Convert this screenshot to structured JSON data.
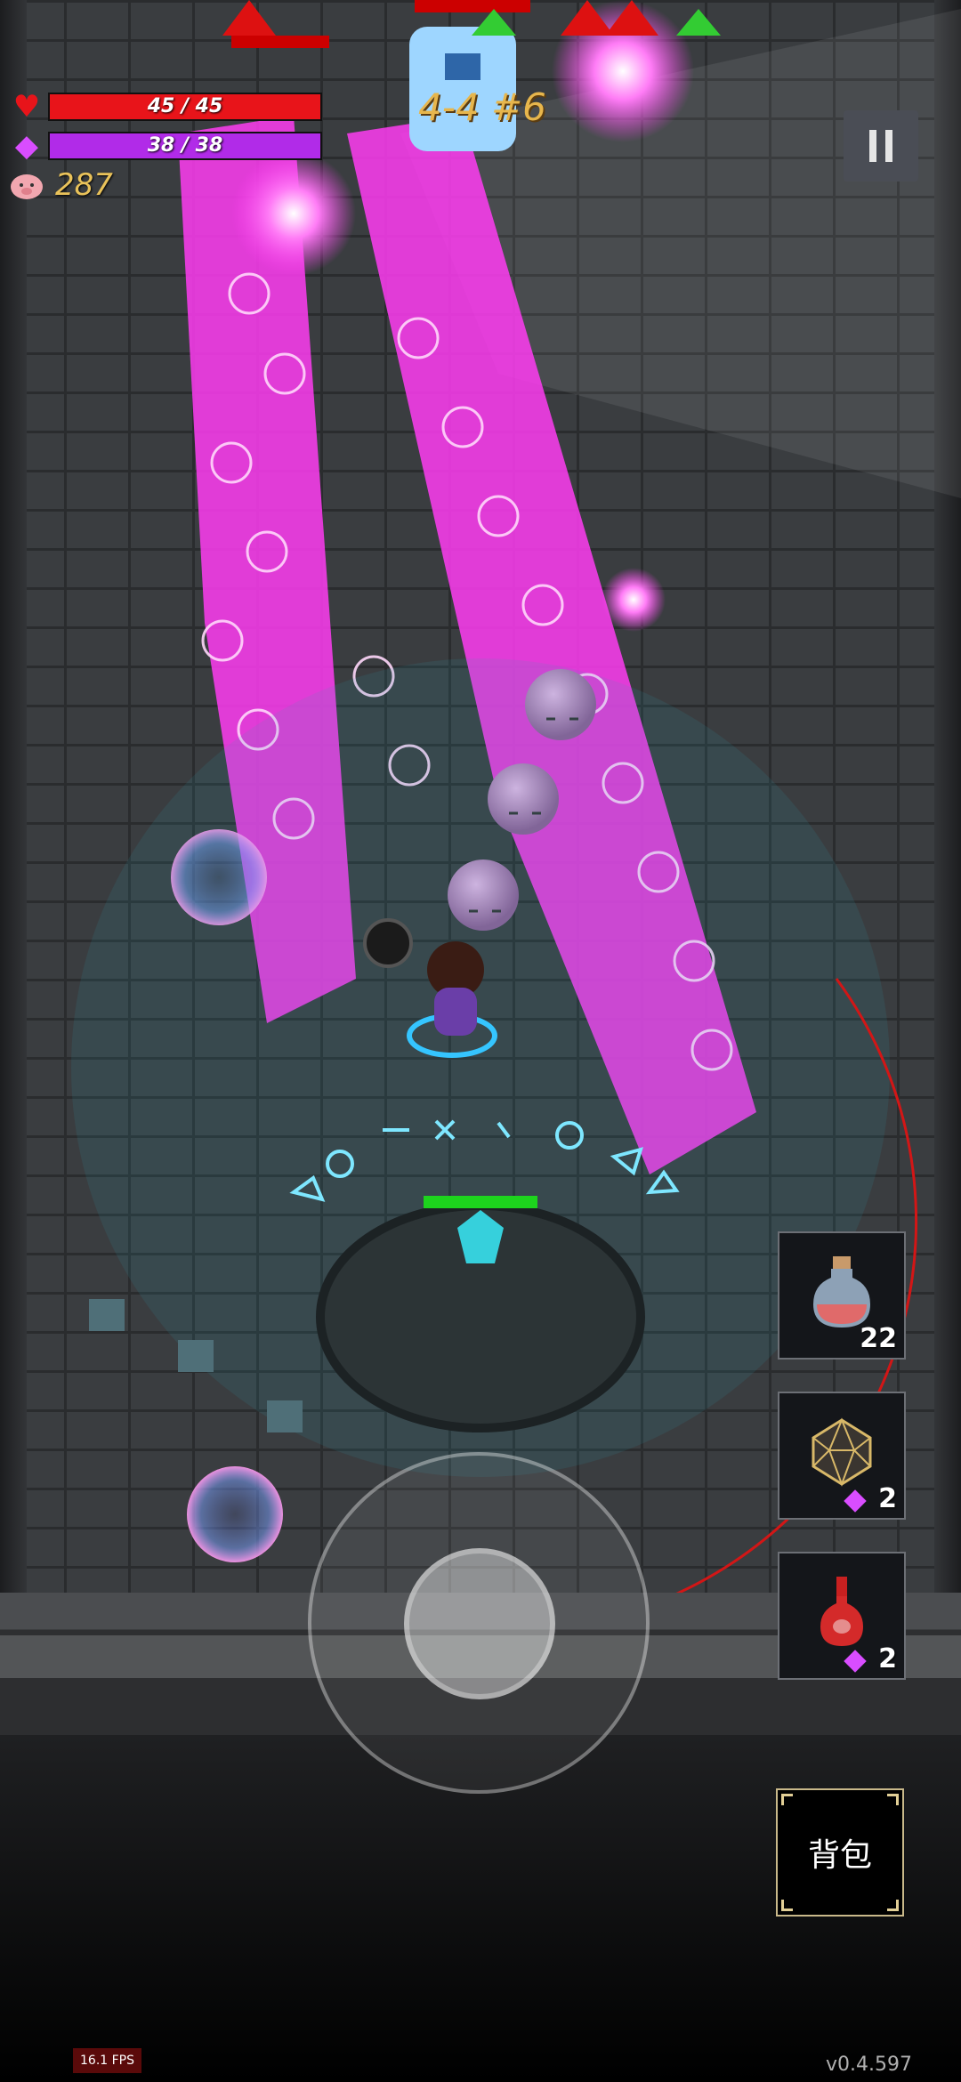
{
  "hud": {
    "hp_text": "45 / 45",
    "hp_fraction": 1.0,
    "hp_color": "#e8141a",
    "mana_text": "38 / 38",
    "mana_fraction": 1.0,
    "mana_color": "#b12be8",
    "coins": "287",
    "stage": "4-4 #6"
  },
  "buttons": {
    "pause_icon": "pause-icon",
    "bag_label": "背包"
  },
  "items": [
    {
      "icon": "health-potion-icon",
      "count": "22",
      "cost_icon": ""
    },
    {
      "icon": "d20-dice-icon",
      "count": "2",
      "cost_icon": "gem-icon"
    },
    {
      "icon": "red-flask-icon",
      "count": "2",
      "cost_icon": "gem-icon"
    }
  ],
  "footer": {
    "fps": "16.1 FPS",
    "version": "v0.4.597"
  },
  "colors": {
    "magic_beam": "#ff3cf2",
    "enemy_orb": "#c590c8",
    "rune_glow": "#7ee7ff",
    "accent_gold": "#e7b64c"
  }
}
